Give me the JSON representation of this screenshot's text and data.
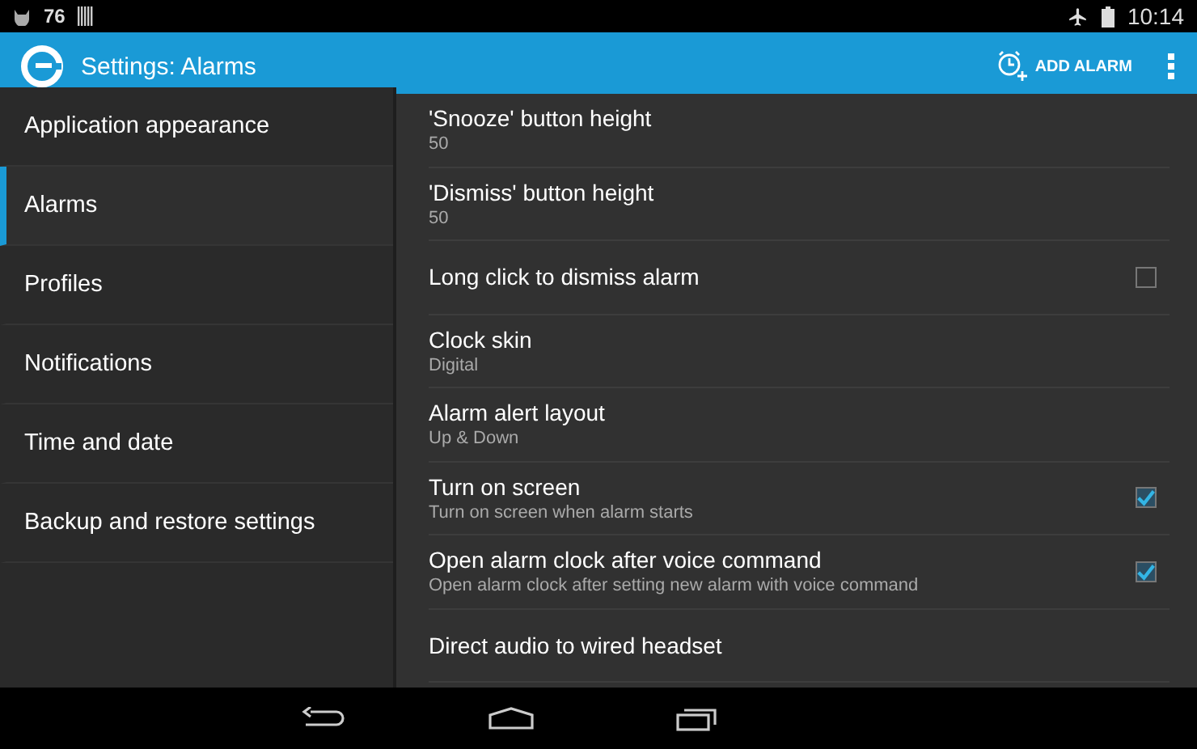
{
  "status_bar": {
    "left_text": "76",
    "time": "10:14"
  },
  "action_bar": {
    "title": "Settings: Alarms",
    "action": "ADD ALARM"
  },
  "sidebar": {
    "items": [
      {
        "label": "Application appearance",
        "selected": false
      },
      {
        "label": "Alarms",
        "selected": true
      },
      {
        "label": "Profiles",
        "selected": false
      },
      {
        "label": "Notifications",
        "selected": false
      },
      {
        "label": "Time and date",
        "selected": false
      },
      {
        "label": "Backup and restore settings",
        "selected": false
      }
    ]
  },
  "settings": [
    {
      "kind": "value",
      "title": "'Snooze' button height",
      "summary": "50"
    },
    {
      "kind": "value",
      "title": "'Dismiss' button height",
      "summary": "50"
    },
    {
      "kind": "checkbox",
      "title": "Long click to dismiss alarm",
      "checked": false
    },
    {
      "kind": "value",
      "title": "Clock skin",
      "summary": "Digital"
    },
    {
      "kind": "value",
      "title": "Alarm alert layout",
      "summary": "Up & Down"
    },
    {
      "kind": "checkbox",
      "title": "Turn on screen",
      "summary": "Turn on screen when alarm starts",
      "checked": true
    },
    {
      "kind": "checkbox",
      "title": "Open alarm clock after voice command",
      "summary": "Open alarm clock after setting new alarm with voice command",
      "checked": true
    },
    {
      "kind": "value",
      "title": "Direct audio to wired headset"
    }
  ]
}
